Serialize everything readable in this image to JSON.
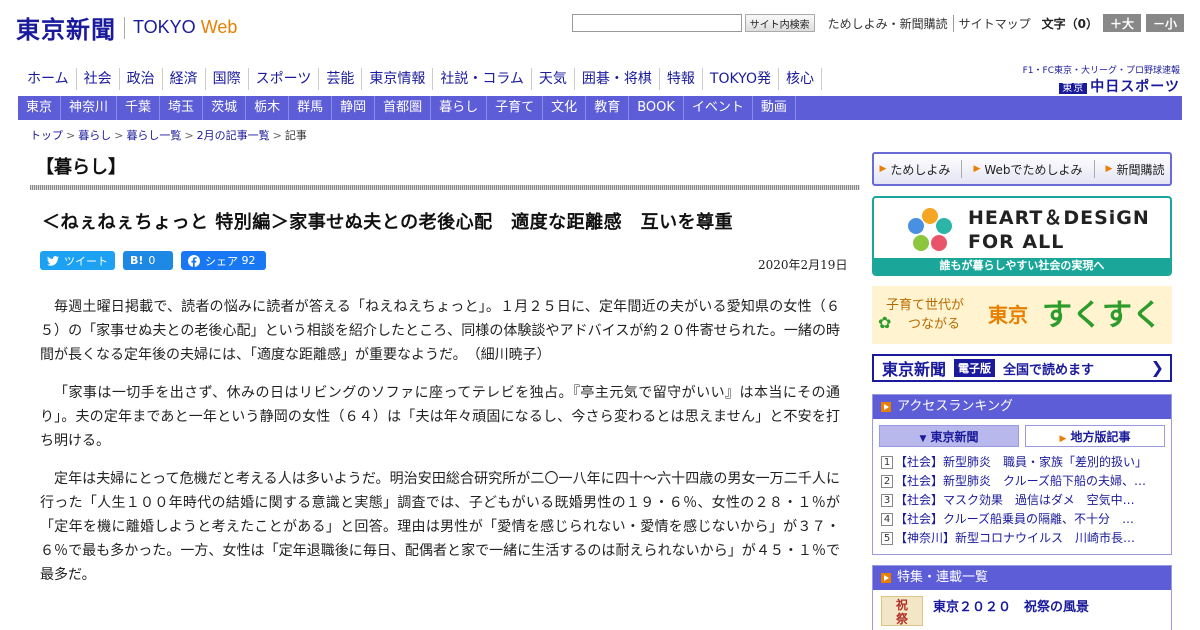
{
  "header": {
    "logo_jp": "東京新聞",
    "logo_en_a": "TOKYO ",
    "logo_en_b": "Web",
    "search_button": "サイト内検索",
    "util_links": [
      "ためしよみ・新聞購読",
      "サイトマップ"
    ],
    "font_size_label": "文字（0）",
    "font_larger": "＋大",
    "font_smaller": "－小"
  },
  "mainnav": [
    "ホーム",
    "社会",
    "政治",
    "経済",
    "国際",
    "スポーツ",
    "芸能",
    "東京情報",
    "社説・コラム",
    "天気",
    "囲碁・将棋",
    "特報",
    "TOKYO発",
    "核心"
  ],
  "chunichi": {
    "small": "F1・FC東京・大リーグ・プロ野球速報",
    "badge": "東京",
    "big": "中日スポーツ"
  },
  "subnav": [
    "東京",
    "神奈川",
    "千葉",
    "埼玉",
    "茨城",
    "栃木",
    "群馬",
    "静岡",
    "首都圏",
    "暮らし",
    "子育て",
    "文化",
    "教育",
    "BOOK",
    "イベント",
    "動画"
  ],
  "breadcrumb": [
    "トップ",
    "暮らし",
    "暮らし一覧",
    "2月の記事一覧",
    "記事"
  ],
  "article": {
    "section": "【暮らし】",
    "headline": "＜ねぇねぇちょっと 特別編＞家事せぬ夫との老後心配　適度な距離感　互いを尊重",
    "date": "2020年2月19日",
    "share": {
      "tweet": "ツイート",
      "hatena_icon": "B!",
      "hatena_count": "0",
      "fb_label": "シェア",
      "fb_count": "92"
    },
    "paragraphs": [
      "毎週土曜日掲載で、読者の悩みに読者が答える「ねえねえちょっと」。１月２５日に、定年間近の夫がいる愛知県の女性（６５）の「家事せぬ夫との老後心配」という相談を紹介したところ、同様の体験談やアドバイスが約２０件寄せられた。一緒の時間が長くなる定年後の夫婦には、「適度な距離感」が重要なようだ。　（細川暁子）",
      "「家事は一切手を出さず、休みの日はリビングのソファに座ってテレビを独占。『亭主元気で留守がいい』は本当にその通り」。夫の定年まであと一年という静岡の女性（６４）は「夫は年々頑固になるし、今さら変わるとは思えません」と不安を打ち明ける。",
      "定年は夫婦にとって危機だと考える人は多いようだ。明治安田総合研究所が二〇一八年に四十～六十四歳の男女一万二千人に行った「人生１００年時代の結婚に関する意識と実態」調査では、子どもがいる既婚男性の１９・６％、女性の２８・１％が「定年を機に離婚しようと考えたことがある」と回答。理由は男性が「愛情を感じられない・愛情を感じないから」が３７・６％で最も多かった。一方、女性は「定年退職後に毎日、配偶者と家で一緒に生活するのは耐えられないから」が４５・１％で最多だ。"
    ]
  },
  "sidebar": {
    "quick": [
      "ためしよみ",
      "Webでためしよみ",
      "新聞購読"
    ],
    "heart_line1": "HEART＆DESiGN",
    "heart_line2": "FOR ALL",
    "heart_bar": "誰もが暮らしやすい社会の実現へ",
    "sukusuku": {
      "line1": "子育て世代が",
      "line2": "つながる",
      "tokyo": "東京",
      "sukusuku": "すくすく"
    },
    "denshi": {
      "name": "東京新聞",
      "badge": "電子版",
      "read": "全国で読めます"
    },
    "ranking": {
      "title": "アクセスランキング",
      "tab_active": "東京新聞",
      "tab_other": "地方版記事",
      "items": [
        {
          "num": "1",
          "text": "【社会】新型肺炎　職員・家族「差別的扱い」"
        },
        {
          "num": "2",
          "text": "【社会】新型肺炎　クルーズ船下船の夫婦、…"
        },
        {
          "num": "3",
          "text": "【社会】マスク効果　過信はダメ　空気中…"
        },
        {
          "num": "4",
          "text": "【社会】クルーズ船乗員の隔離、不十分　…"
        },
        {
          "num": "5",
          "text": "【神奈川】新型コロナウイルス　川崎市長…"
        }
      ]
    },
    "tokushu": {
      "title": "特集・連載一覧",
      "img_text": "祝\n祭",
      "item": "東京２０２０　祝祭の風景"
    }
  }
}
